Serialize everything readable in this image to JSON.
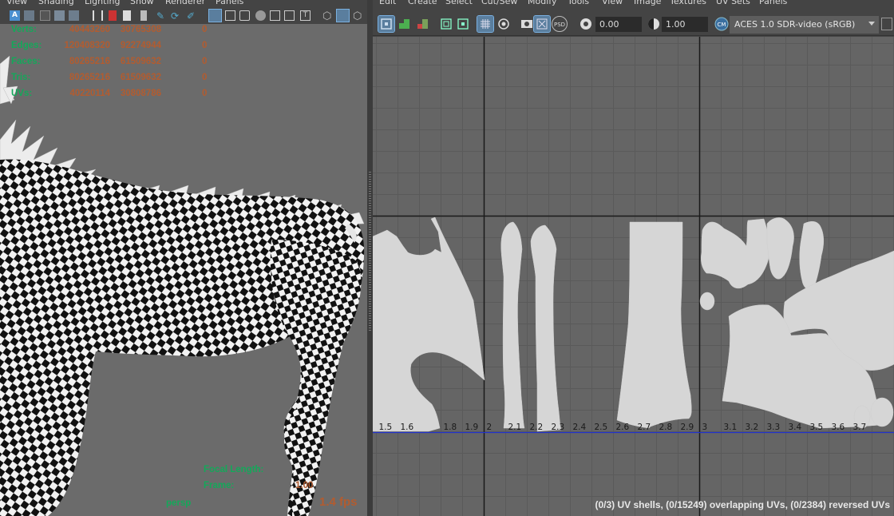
{
  "viewport": {
    "menu": [
      "View",
      "Shading",
      "Lighting",
      "Show",
      "Renderer",
      "Panels"
    ],
    "hud": {
      "rows": [
        {
          "label": "Verts:",
          "v1": "40443260",
          "v2": "30765308",
          "v3": "0"
        },
        {
          "label": "Edges:",
          "v1": "120408320",
          "v2": "92274944",
          "v3": "0"
        },
        {
          "label": "Faces:",
          "v1": "80265216",
          "v2": "61509632",
          "v3": "0"
        },
        {
          "label": "Tris:",
          "v1": "80265216",
          "v2": "61509632",
          "v3": "0"
        },
        {
          "label": "UVs:",
          "v1": "40220114",
          "v2": "30808786",
          "v3": "0"
        }
      ],
      "focal_length_label": "Focal Length:",
      "frame_label": "Frame:",
      "frame_value": "1.00",
      "camera": "persp",
      "fps": "1.4 fps"
    }
  },
  "uv_editor": {
    "menu": [
      "Edit",
      "Create",
      "Select",
      "Cut/Sew",
      "Modify",
      "Tools",
      "View",
      "Image",
      "Textures",
      "UV Sets",
      "Panels"
    ],
    "exposure": "0.00",
    "gamma": "1.00",
    "color_management": "ACES 1.0 SDR-video (sRGB)",
    "icons": [
      "uv-shell-icon",
      "texture-border-icon",
      "distortion-icon",
      "checker-icon",
      "grid-icon",
      "pixel-snap-icon",
      "image-display-icon",
      "dim-image-icon",
      "psd-icon",
      "exposure-icon",
      "gamma-icon",
      "color-management-icon"
    ],
    "axis_ticks": [
      "1.5",
      "1.6",
      "1.8",
      "1.9",
      "2",
      "2.1",
      "2.2",
      "2.3",
      "2.4",
      "2.5",
      "2.6",
      "2.7",
      "2.8",
      "2.9",
      "3",
      "3.1",
      "3.2",
      "3.3",
      "3.4",
      "3.5",
      "3.6",
      "3.7"
    ],
    "status": "(0/3) UV shells, (0/15249) overlapping UVs, (0/2384) reversed UVs",
    "colors": {
      "canvas": "#656565",
      "grid": "#5a5a5a",
      "axis": "#1a1a1a",
      "u_line": "#2233cc",
      "shell": "#d6d6d6",
      "hud_green": "#14a85a",
      "hud_orange": "#b25c30"
    }
  }
}
